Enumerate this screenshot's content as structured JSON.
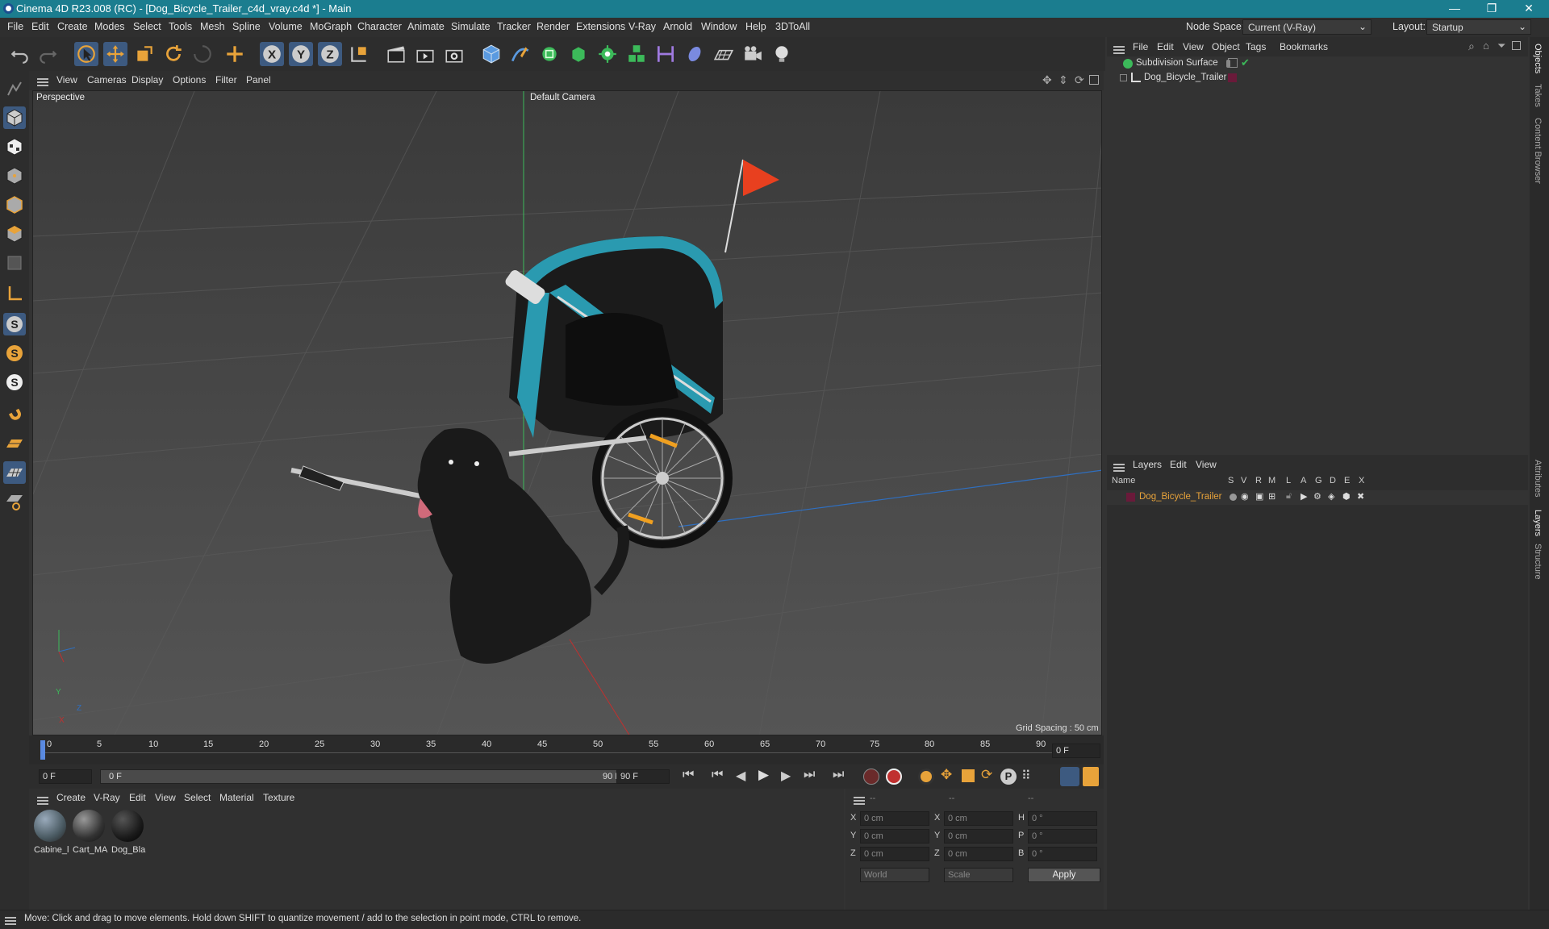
{
  "window": {
    "title": "Cinema 4D R23.008 (RC) - [Dog_Bicycle_Trailer_c4d_vray.c4d *] - Main",
    "minimize": "—",
    "maximize": "❐",
    "close": "✕"
  },
  "menu": [
    "File",
    "Edit",
    "Create",
    "Modes",
    "Select",
    "Tools",
    "Mesh",
    "Spline",
    "Volume",
    "MoGraph",
    "Character",
    "Animate",
    "Simulate",
    "Tracker",
    "Render",
    "Extensions",
    "V-Ray",
    "Arnold",
    "Window",
    "Help",
    "3DToAll"
  ],
  "node_space": {
    "label": "Node Space:",
    "value": "Current (V-Ray)"
  },
  "layout": {
    "label": "Layout:",
    "value": "Startup"
  },
  "viewport": {
    "menu": [
      "View",
      "Cameras",
      "Display",
      "Options",
      "Filter",
      "Panel"
    ],
    "name": "Perspective",
    "camera": "Default Camera",
    "grid_spacing": "Grid Spacing : 50 cm",
    "axis_y": "Y",
    "axis_z": "Z",
    "axis_x": "X"
  },
  "timeline": {
    "ticks": [
      "0",
      "5",
      "10",
      "15",
      "20",
      "25",
      "30",
      "35",
      "40",
      "45",
      "50",
      "55",
      "60",
      "65",
      "70",
      "75",
      "80",
      "85",
      "90"
    ],
    "current_frame": "0 F"
  },
  "transport": {
    "start": "0 F",
    "range_start": "0 F",
    "range_end": "90 F",
    "end": "90 F"
  },
  "material_panel": {
    "menu": [
      "Create",
      "V-Ray",
      "Edit",
      "View",
      "Select",
      "Material",
      "Texture"
    ],
    "materials": [
      {
        "name": "Cabine_l",
        "color": "#5a6e78"
      },
      {
        "name": "Cart_MA",
        "color": "#3a3a3a"
      },
      {
        "name": "Dog_Bla",
        "color": "#222222"
      }
    ]
  },
  "coords": {
    "headers": [
      "--",
      "--",
      "--"
    ],
    "rows": [
      {
        "a": "X",
        "av": "0 cm",
        "b": "X",
        "bv": "0 cm",
        "c": "H",
        "cv": "0 °"
      },
      {
        "a": "Y",
        "av": "0 cm",
        "b": "Y",
        "bv": "0 cm",
        "c": "P",
        "cv": "0 °"
      },
      {
        "a": "Z",
        "av": "0 cm",
        "b": "Z",
        "bv": "0 cm",
        "c": "B",
        "cv": "0 °"
      }
    ],
    "world": "World",
    "scale": "Scale",
    "apply": "Apply"
  },
  "objects_panel": {
    "menu": [
      "File",
      "Edit",
      "View",
      "Object",
      "Tags",
      "Bookmarks"
    ],
    "items": [
      {
        "name": "Subdivision Surface"
      },
      {
        "name": "Dog_Bicycle_Trailer"
      }
    ]
  },
  "layers_panel": {
    "menu": [
      "Layers",
      "Edit",
      "View"
    ],
    "col_name": "Name",
    "cols": [
      "S",
      "V",
      "R",
      "M",
      "L",
      "A",
      "G",
      "D",
      "E",
      "X"
    ],
    "items": [
      {
        "name": "Dog_Bicycle_Trailer",
        "color": "#6a1a3a"
      }
    ]
  },
  "right_tabs": [
    "Objects",
    "Takes",
    "Content Browser",
    "Attributes",
    "Layers",
    "Structure"
  ],
  "status": "Move: Click and drag to move elements. Hold down SHIFT to quantize movement / add to the selection in point mode, CTRL to remove."
}
